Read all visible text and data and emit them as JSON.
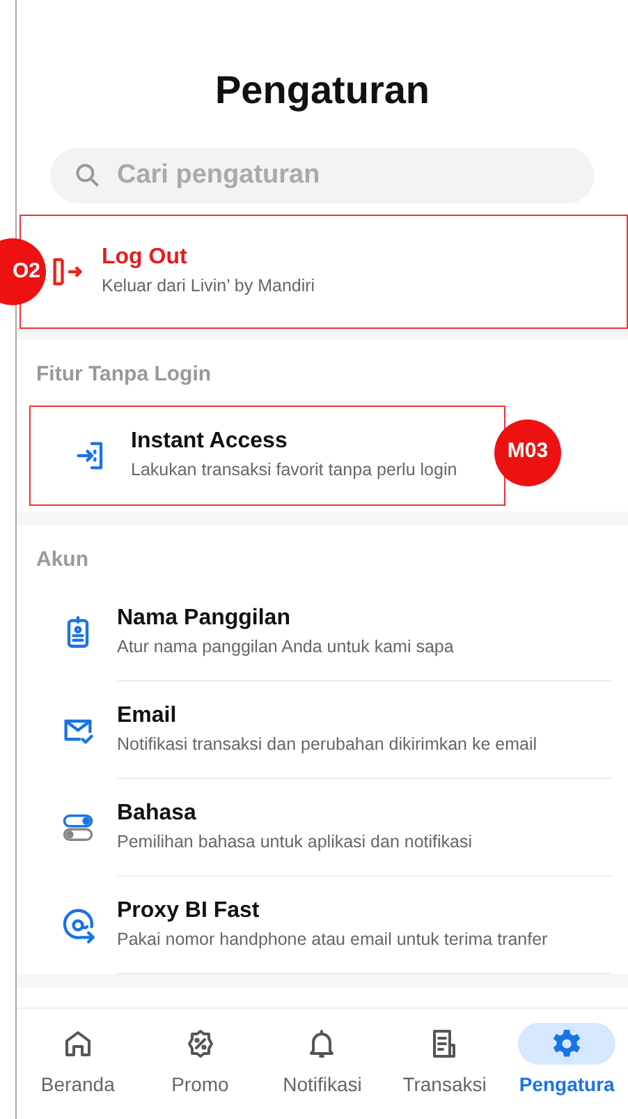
{
  "title": "Pengaturan",
  "search": {
    "placeholder": "Cari pengaturan"
  },
  "logout": {
    "title": "Log Out",
    "subtitle": "Keluar dari Livin’ by Mandiri",
    "annotation": "O2"
  },
  "sections": [
    {
      "heading": "Fitur Tanpa Login",
      "items": [
        {
          "title": "Instant Access",
          "subtitle": "Lakukan transaksi favorit tanpa perlu login",
          "annotation": "M03"
        }
      ]
    },
    {
      "heading": "Akun",
      "items": [
        {
          "title": "Nama Panggilan",
          "subtitle": "Atur nama panggilan Anda untuk kami sapa"
        },
        {
          "title": "Email",
          "subtitle": "Notifikasi transaksi dan perubahan dikirimkan ke email"
        },
        {
          "title": "Bahasa",
          "subtitle": "Pemilihan bahasa untuk aplikasi dan notifikasi"
        },
        {
          "title": "Proxy BI Fast",
          "subtitle": "Pakai nomor handphone atau email untuk terima tranfer"
        }
      ]
    }
  ],
  "nav": [
    {
      "label": "Beranda",
      "selected": false
    },
    {
      "label": "Promo",
      "selected": false
    },
    {
      "label": "Notifikasi",
      "selected": false
    },
    {
      "label": "Transaksi",
      "selected": false
    },
    {
      "label": "Pengatura",
      "selected": true
    }
  ]
}
